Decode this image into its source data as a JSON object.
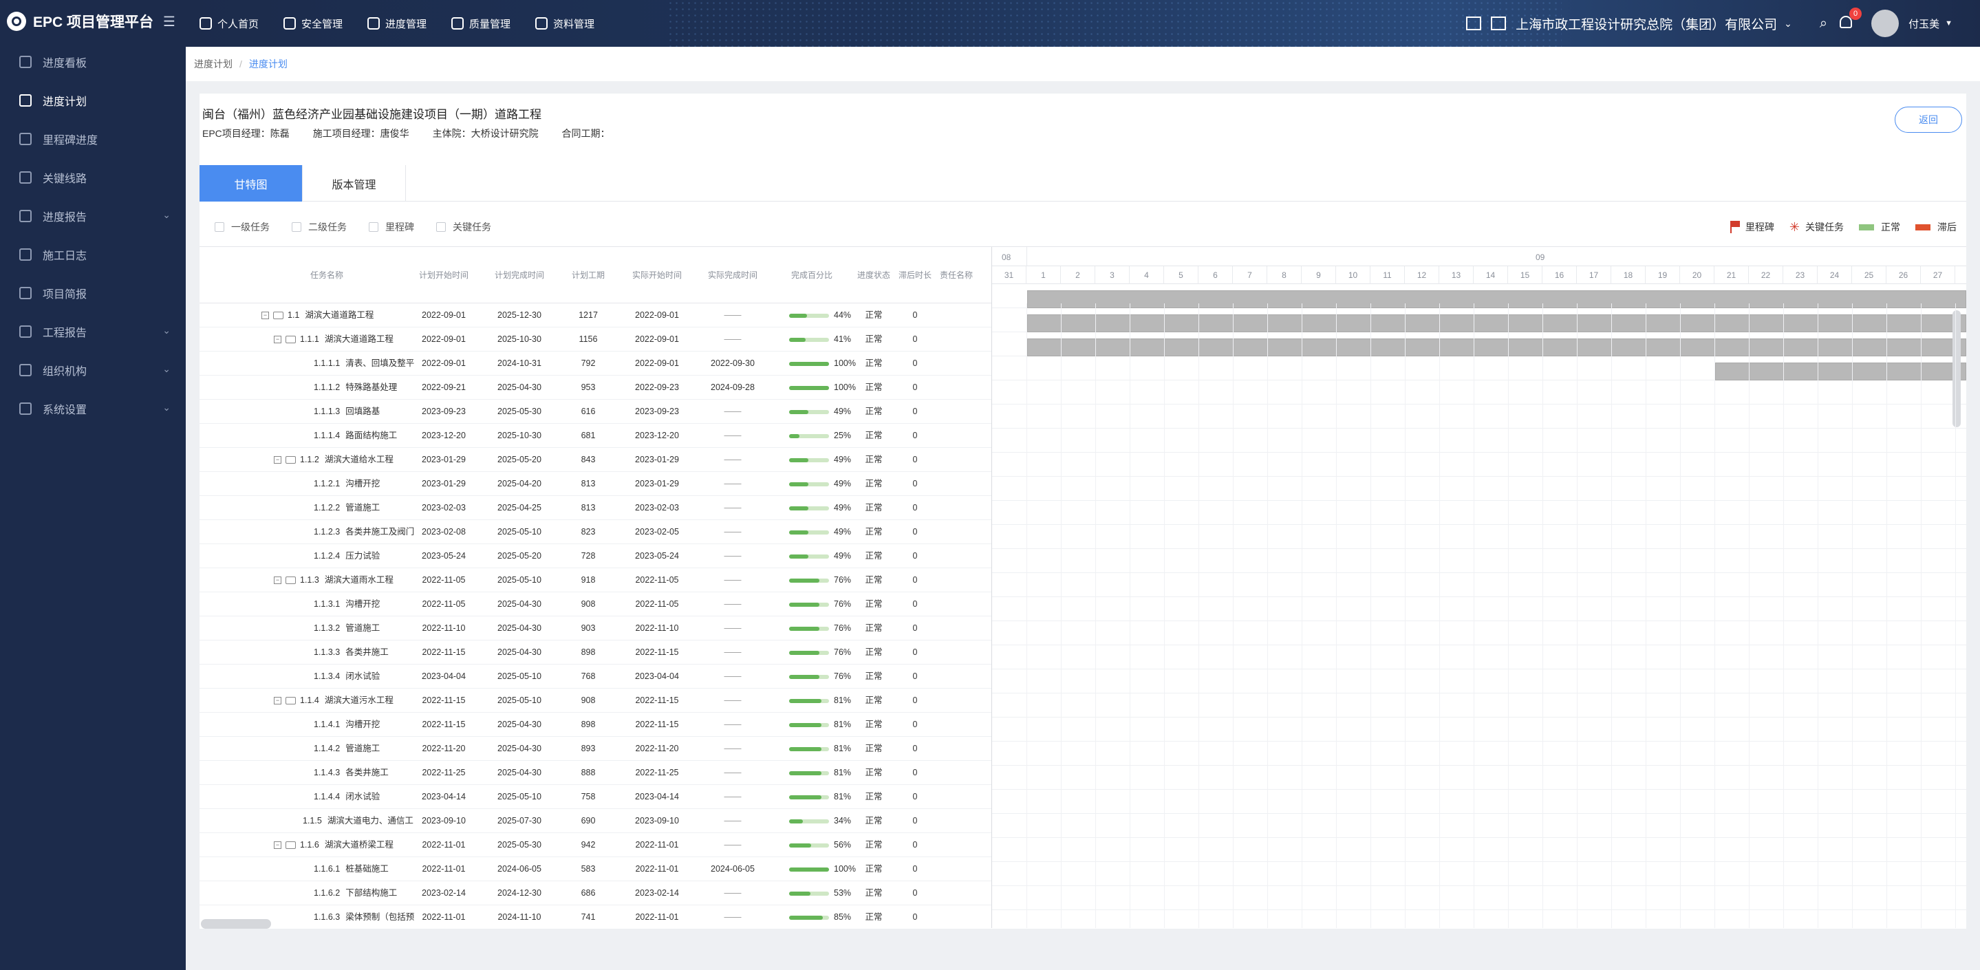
{
  "app": {
    "title": "EPC 项目管理平台"
  },
  "sidebar": {
    "items": [
      {
        "label": "进度看板"
      },
      {
        "label": "进度计划",
        "active": true
      },
      {
        "label": "里程碑进度"
      },
      {
        "label": "关键线路"
      },
      {
        "label": "进度报告",
        "expandable": true
      },
      {
        "label": "施工日志"
      },
      {
        "label": "项目简报"
      },
      {
        "label": "工程报告",
        "expandable": true
      },
      {
        "label": "组织机构",
        "expandable": true
      },
      {
        "label": "系统设置",
        "expandable": true
      }
    ]
  },
  "topnav": {
    "items": [
      "个人首页",
      "安全管理",
      "进度管理",
      "质量管理",
      "资料管理"
    ]
  },
  "user": {
    "org": "上海市政工程设计研究总院（集团）有限公司",
    "name": "付玉美",
    "notifications": "0"
  },
  "breadcrumb": {
    "parent": "进度计划",
    "current": "进度计划"
  },
  "project": {
    "title": "闽台（福州）蓝色经济产业园基础设施建设项目（一期）道路工程",
    "epc_manager": "EPC项目经理：陈磊",
    "construction_manager": "施工项目经理：唐俊华",
    "lead_institute": "主体院：大桥设计研究院",
    "contract_period": "合同工期：",
    "back_label": "返回"
  },
  "tabs": [
    "甘特图",
    "版本管理"
  ],
  "filters": [
    "一级任务",
    "二级任务",
    "里程碑",
    "关键任务"
  ],
  "legend": {
    "milestone": "里程碑",
    "critical": "关键任务",
    "normal": "正常",
    "delayed": "滞后",
    "colors": {
      "milestone": "#d23b2b",
      "critical": "#d23b2b",
      "normal": "#8fc57f",
      "delayed": "#e0522e"
    }
  },
  "columns": [
    "任务名称",
    "计划开始时间",
    "计划完成时间",
    "计划工期",
    "实际开始时间",
    "实际完成时间",
    "完成百分比",
    "进度状态",
    "滞后时长",
    "责任名称"
  ],
  "tasks": [
    {
      "code": "1.1",
      "name": "湖滨大道道路工程",
      "level": 1,
      "ps": "2022-09-01",
      "pe": "2025-12-30",
      "dur": "1217",
      "as": "2022-09-01",
      "ae": "——",
      "pct": 44,
      "pct_label": "44%",
      "status": "正常",
      "lag": "0"
    },
    {
      "code": "1.1.1",
      "name": "湖滨大道道路工程",
      "level": 2,
      "ps": "2022-09-01",
      "pe": "2025-10-30",
      "dur": "1156",
      "as": "2022-09-01",
      "ae": "——",
      "pct": 41,
      "pct_label": "41%",
      "status": "正常",
      "lag": "0"
    },
    {
      "code": "1.1.1.1",
      "name": "清表、回填及整平",
      "level": 3,
      "ps": "2022-09-01",
      "pe": "2024-10-31",
      "dur": "792",
      "as": "2022-09-01",
      "ae": "2022-09-30",
      "pct": 100,
      "pct_label": "100%",
      "status": "正常",
      "lag": "0"
    },
    {
      "code": "1.1.1.2",
      "name": "特殊路基处理",
      "level": 3,
      "ps": "2022-09-21",
      "pe": "2025-04-30",
      "dur": "953",
      "as": "2022-09-23",
      "ae": "2024-09-28",
      "pct": 100,
      "pct_label": "100%",
      "status": "正常",
      "lag": "0"
    },
    {
      "code": "1.1.1.3",
      "name": "回填路基",
      "level": 3,
      "ps": "2023-09-23",
      "pe": "2025-05-30",
      "dur": "616",
      "as": "2023-09-23",
      "ae": "——",
      "pct": 49,
      "pct_label": "49%",
      "status": "正常",
      "lag": "0"
    },
    {
      "code": "1.1.1.4",
      "name": "路面结构施工",
      "level": 3,
      "ps": "2023-12-20",
      "pe": "2025-10-30",
      "dur": "681",
      "as": "2023-12-20",
      "ae": "——",
      "pct": 25,
      "pct_label": "25%",
      "status": "正常",
      "lag": "0"
    },
    {
      "code": "1.1.2",
      "name": "湖滨大道给水工程",
      "level": 2,
      "ps": "2023-01-29",
      "pe": "2025-05-20",
      "dur": "843",
      "as": "2023-01-29",
      "ae": "——",
      "pct": 49,
      "pct_label": "49%",
      "status": "正常",
      "lag": "0"
    },
    {
      "code": "1.1.2.1",
      "name": "沟槽开挖",
      "level": 3,
      "ps": "2023-01-29",
      "pe": "2025-04-20",
      "dur": "813",
      "as": "2023-01-29",
      "ae": "——",
      "pct": 49,
      "pct_label": "49%",
      "status": "正常",
      "lag": "0"
    },
    {
      "code": "1.1.2.2",
      "name": "管道施工",
      "level": 3,
      "ps": "2023-02-03",
      "pe": "2025-04-25",
      "dur": "813",
      "as": "2023-02-03",
      "ae": "——",
      "pct": 49,
      "pct_label": "49%",
      "status": "正常",
      "lag": "0"
    },
    {
      "code": "1.1.2.3",
      "name": "各类井施工及阀门",
      "level": 3,
      "ps": "2023-02-08",
      "pe": "2025-05-10",
      "dur": "823",
      "as": "2023-02-05",
      "ae": "——",
      "pct": 49,
      "pct_label": "49%",
      "status": "正常",
      "lag": "0"
    },
    {
      "code": "1.1.2.4",
      "name": "压力试验",
      "level": 3,
      "ps": "2023-05-24",
      "pe": "2025-05-20",
      "dur": "728",
      "as": "2023-05-24",
      "ae": "——",
      "pct": 49,
      "pct_label": "49%",
      "status": "正常",
      "lag": "0"
    },
    {
      "code": "1.1.3",
      "name": "湖滨大道雨水工程",
      "level": 2,
      "ps": "2022-11-05",
      "pe": "2025-05-10",
      "dur": "918",
      "as": "2022-11-05",
      "ae": "——",
      "pct": 76,
      "pct_label": "76%",
      "status": "正常",
      "lag": "0"
    },
    {
      "code": "1.1.3.1",
      "name": "沟槽开挖",
      "level": 3,
      "ps": "2022-11-05",
      "pe": "2025-04-30",
      "dur": "908",
      "as": "2022-11-05",
      "ae": "——",
      "pct": 76,
      "pct_label": "76%",
      "status": "正常",
      "lag": "0"
    },
    {
      "code": "1.1.3.2",
      "name": "管道施工",
      "level": 3,
      "ps": "2022-11-10",
      "pe": "2025-04-30",
      "dur": "903",
      "as": "2022-11-10",
      "ae": "——",
      "pct": 76,
      "pct_label": "76%",
      "status": "正常",
      "lag": "0"
    },
    {
      "code": "1.1.3.3",
      "name": "各类井施工",
      "level": 3,
      "ps": "2022-11-15",
      "pe": "2025-04-30",
      "dur": "898",
      "as": "2022-11-15",
      "ae": "——",
      "pct": 76,
      "pct_label": "76%",
      "status": "正常",
      "lag": "0"
    },
    {
      "code": "1.1.3.4",
      "name": "闭水试验",
      "level": 3,
      "ps": "2023-04-04",
      "pe": "2025-05-10",
      "dur": "768",
      "as": "2023-04-04",
      "ae": "——",
      "pct": 76,
      "pct_label": "76%",
      "status": "正常",
      "lag": "0"
    },
    {
      "code": "1.1.4",
      "name": "湖滨大道污水工程",
      "level": 2,
      "ps": "2022-11-15",
      "pe": "2025-05-10",
      "dur": "908",
      "as": "2022-11-15",
      "ae": "——",
      "pct": 81,
      "pct_label": "81%",
      "status": "正常",
      "lag": "0"
    },
    {
      "code": "1.1.4.1",
      "name": "沟槽开挖",
      "level": 3,
      "ps": "2022-11-15",
      "pe": "2025-04-30",
      "dur": "898",
      "as": "2022-11-15",
      "ae": "——",
      "pct": 81,
      "pct_label": "81%",
      "status": "正常",
      "lag": "0"
    },
    {
      "code": "1.1.4.2",
      "name": "管道施工",
      "level": 3,
      "ps": "2022-11-20",
      "pe": "2025-04-30",
      "dur": "893",
      "as": "2022-11-20",
      "ae": "——",
      "pct": 81,
      "pct_label": "81%",
      "status": "正常",
      "lag": "0"
    },
    {
      "code": "1.1.4.3",
      "name": "各类井施工",
      "level": 3,
      "ps": "2022-11-25",
      "pe": "2025-04-30",
      "dur": "888",
      "as": "2022-11-25",
      "ae": "——",
      "pct": 81,
      "pct_label": "81%",
      "status": "正常",
      "lag": "0"
    },
    {
      "code": "1.1.4.4",
      "name": "闭水试验",
      "level": 3,
      "ps": "2023-04-14",
      "pe": "2025-05-10",
      "dur": "758",
      "as": "2023-04-14",
      "ae": "——",
      "pct": 81,
      "pct_label": "81%",
      "status": "正常",
      "lag": "0"
    },
    {
      "code": "1.1.5",
      "name": "湖滨大道电力、通信工",
      "level": 2,
      "leaf": true,
      "ps": "2023-09-10",
      "pe": "2025-07-30",
      "dur": "690",
      "as": "2023-09-10",
      "ae": "——",
      "pct": 34,
      "pct_label": "34%",
      "status": "正常",
      "lag": "0"
    },
    {
      "code": "1.1.6",
      "name": "湖滨大道桥梁工程",
      "level": 2,
      "ps": "2022-11-01",
      "pe": "2025-05-30",
      "dur": "942",
      "as": "2022-11-01",
      "ae": "——",
      "pct": 56,
      "pct_label": "56%",
      "status": "正常",
      "lag": "0"
    },
    {
      "code": "1.1.6.1",
      "name": "桩基础施工",
      "level": 3,
      "ps": "2022-11-01",
      "pe": "2024-06-05",
      "dur": "583",
      "as": "2022-11-01",
      "ae": "2024-06-05",
      "pct": 100,
      "pct_label": "100%",
      "status": "正常",
      "lag": "0"
    },
    {
      "code": "1.1.6.2",
      "name": "下部结构施工",
      "level": 3,
      "ps": "2023-02-14",
      "pe": "2024-12-30",
      "dur": "686",
      "as": "2023-02-14",
      "ae": "——",
      "pct": 53,
      "pct_label": "53%",
      "status": "正常",
      "lag": "0"
    },
    {
      "code": "1.1.6.3",
      "name": "梁体预制（包括预",
      "level": 3,
      "ps": "2022-11-01",
      "pe": "2024-11-10",
      "dur": "741",
      "as": "2022-11-01",
      "ae": "——",
      "pct": 85,
      "pct_label": "85%",
      "status": "正常",
      "lag": "0"
    }
  ],
  "gantt": {
    "months": [
      "08",
      "09"
    ],
    "days": [
      "31",
      "1",
      "2",
      "3",
      "4",
      "5",
      "6",
      "7",
      "8",
      "9",
      "10",
      "11",
      "12",
      "13",
      "14",
      "15",
      "16",
      "17",
      "18",
      "19",
      "20",
      "21",
      "22",
      "23",
      "24",
      "25",
      "26",
      "27"
    ]
  }
}
